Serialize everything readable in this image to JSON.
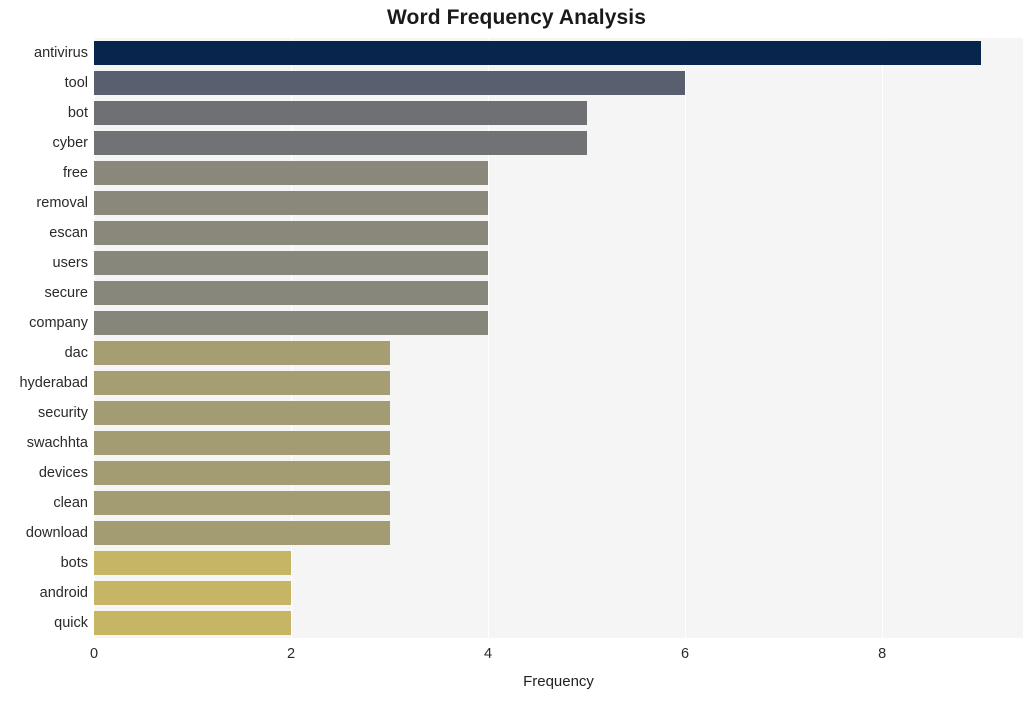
{
  "chart_data": {
    "type": "bar",
    "orientation": "horizontal",
    "title": "Word Frequency Analysis",
    "xlabel": "Frequency",
    "ylabel": "",
    "categories": [
      "antivirus",
      "tool",
      "bot",
      "cyber",
      "free",
      "removal",
      "escan",
      "users",
      "secure",
      "company",
      "dac",
      "hyderabad",
      "security",
      "swachhta",
      "devices",
      "clean",
      "download",
      "bots",
      "android",
      "quick"
    ],
    "values": [
      9,
      6,
      5,
      5,
      4,
      4,
      4,
      4,
      4,
      4,
      3,
      3,
      3,
      3,
      3,
      3,
      3,
      2,
      2,
      2
    ],
    "bar_colors": [
      "#07254d",
      "#5a5f70",
      "#6e7073",
      "#717275",
      "#8a887b",
      "#8a887b",
      "#8a887b",
      "#88877c",
      "#88877c",
      "#87867b",
      "#a69d73",
      "#a69d73",
      "#a39b72",
      "#a39b72",
      "#a39b72",
      "#a39b72",
      "#a39b72",
      "#c5b565",
      "#c5b565",
      "#c5b565"
    ],
    "xlim": [
      0,
      9.43
    ],
    "ylim_count": 20,
    "x_ticks": [
      "0",
      "2",
      "4",
      "6",
      "8"
    ],
    "x_tick_values": [
      0,
      2,
      4,
      6,
      8
    ],
    "grid": true,
    "grid_color": "#ffffff",
    "plot_background": "#f5f5f6",
    "legend": "none"
  }
}
